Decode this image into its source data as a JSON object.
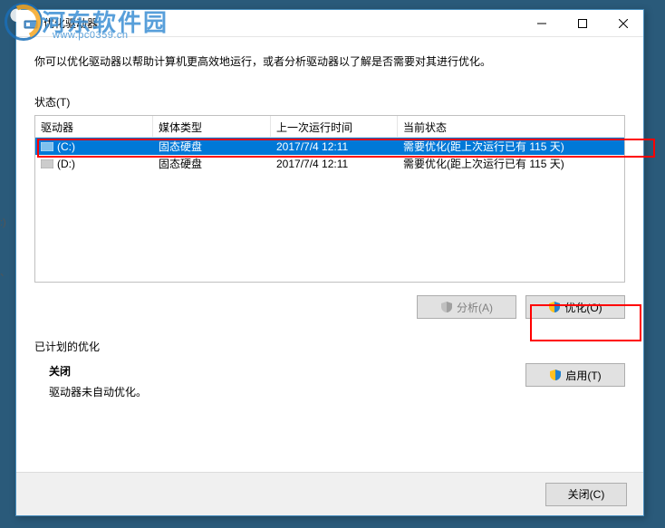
{
  "window": {
    "title": "优化驱动器",
    "description": "你可以优化驱动器以帮助计算机更高效地运行，或者分析驱动器以了解是否需要对其进行优化。",
    "status_label": "状态(T)"
  },
  "table": {
    "headers": {
      "drive": "驱动器",
      "media": "媒体类型",
      "last": "上一次运行时间",
      "state": "当前状态"
    },
    "rows": [
      {
        "drive": "(C:)",
        "media": "固态硬盘",
        "last": "2017/7/4 12:11",
        "state": "需要优化(距上次运行已有 115 天)",
        "selected": true
      },
      {
        "drive": "(D:)",
        "media": "固态硬盘",
        "last": "2017/7/4 12:11",
        "state": "需要优化(距上次运行已有 115 天)",
        "selected": false
      }
    ]
  },
  "buttons": {
    "analyze": "分析(A)",
    "optimize": "优化(O)",
    "enable": "启用(T)",
    "close": "关闭(C)"
  },
  "schedule": {
    "label": "已计划的优化",
    "status": "关闭",
    "detail": "驱动器未自动优化。"
  },
  "watermark": {
    "text": "河东软件园",
    "url": "www.pc0359.cn"
  },
  "misc": {
    "colon": ":)",
    "comma": "、"
  }
}
